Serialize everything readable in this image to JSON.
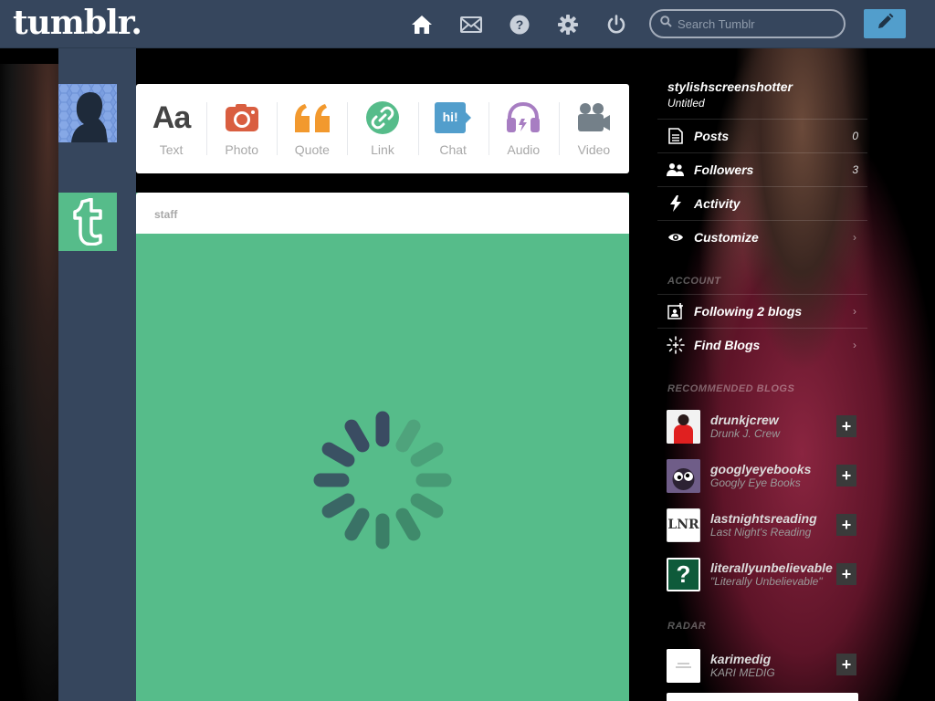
{
  "header": {
    "logo": "tumblr.",
    "search_placeholder": "Search Tumblr",
    "icons": [
      "home-icon",
      "mail-icon",
      "help-icon",
      "gear-icon",
      "power-icon"
    ],
    "accent": "#529ecc",
    "bar_color": "#36465d"
  },
  "post_types": [
    {
      "label": "Text",
      "icon": "text-icon",
      "color": "#444444",
      "glyph": "Aa"
    },
    {
      "label": "Photo",
      "icon": "camera-icon",
      "color": "#d95e40"
    },
    {
      "label": "Quote",
      "icon": "quote-icon",
      "color": "#f2992e"
    },
    {
      "label": "Link",
      "icon": "link-icon",
      "color": "#56bc8a"
    },
    {
      "label": "Chat",
      "icon": "chat-icon",
      "color": "#529ecc",
      "glyph": "hi!"
    },
    {
      "label": "Audio",
      "icon": "headphones-icon",
      "color": "#a77dc2"
    },
    {
      "label": "Video",
      "icon": "video-camera-icon",
      "color": "#748089"
    }
  ],
  "post": {
    "author": "staff",
    "background": "#56bc8a"
  },
  "sidebar": {
    "blog_name": "stylishscreenshotter",
    "blog_title": "Untitled",
    "items": [
      {
        "label": "Posts",
        "count": "0",
        "icon": "posts-icon"
      },
      {
        "label": "Followers",
        "count": "3",
        "icon": "followers-icon"
      },
      {
        "label": "Activity",
        "icon": "lightning-icon"
      },
      {
        "label": "Customize",
        "icon": "eye-icon"
      }
    ],
    "account_heading": "ACCOUNT",
    "account_items": [
      {
        "label": "Following 2 blogs",
        "icon": "following-icon"
      },
      {
        "label": "Find Blogs",
        "icon": "find-blogs-icon"
      }
    ],
    "recommended_heading": "RECOMMENDED BLOGS",
    "recommended": [
      {
        "name": "drunkjcrew",
        "subtitle": "Drunk J. Crew"
      },
      {
        "name": "googlyeyebooks",
        "subtitle": "Googly Eye Books"
      },
      {
        "name": "lastnightsreading",
        "subtitle": "Last Night's Reading",
        "thumb_text": "LNR"
      },
      {
        "name": "literallyunbelievable",
        "subtitle": "\"Literally Unbelievable\"",
        "thumb_text": "?"
      }
    ],
    "radar_heading": "RADAR",
    "radar": {
      "name": "karimedig",
      "subtitle": "KARI MEDIG"
    }
  }
}
